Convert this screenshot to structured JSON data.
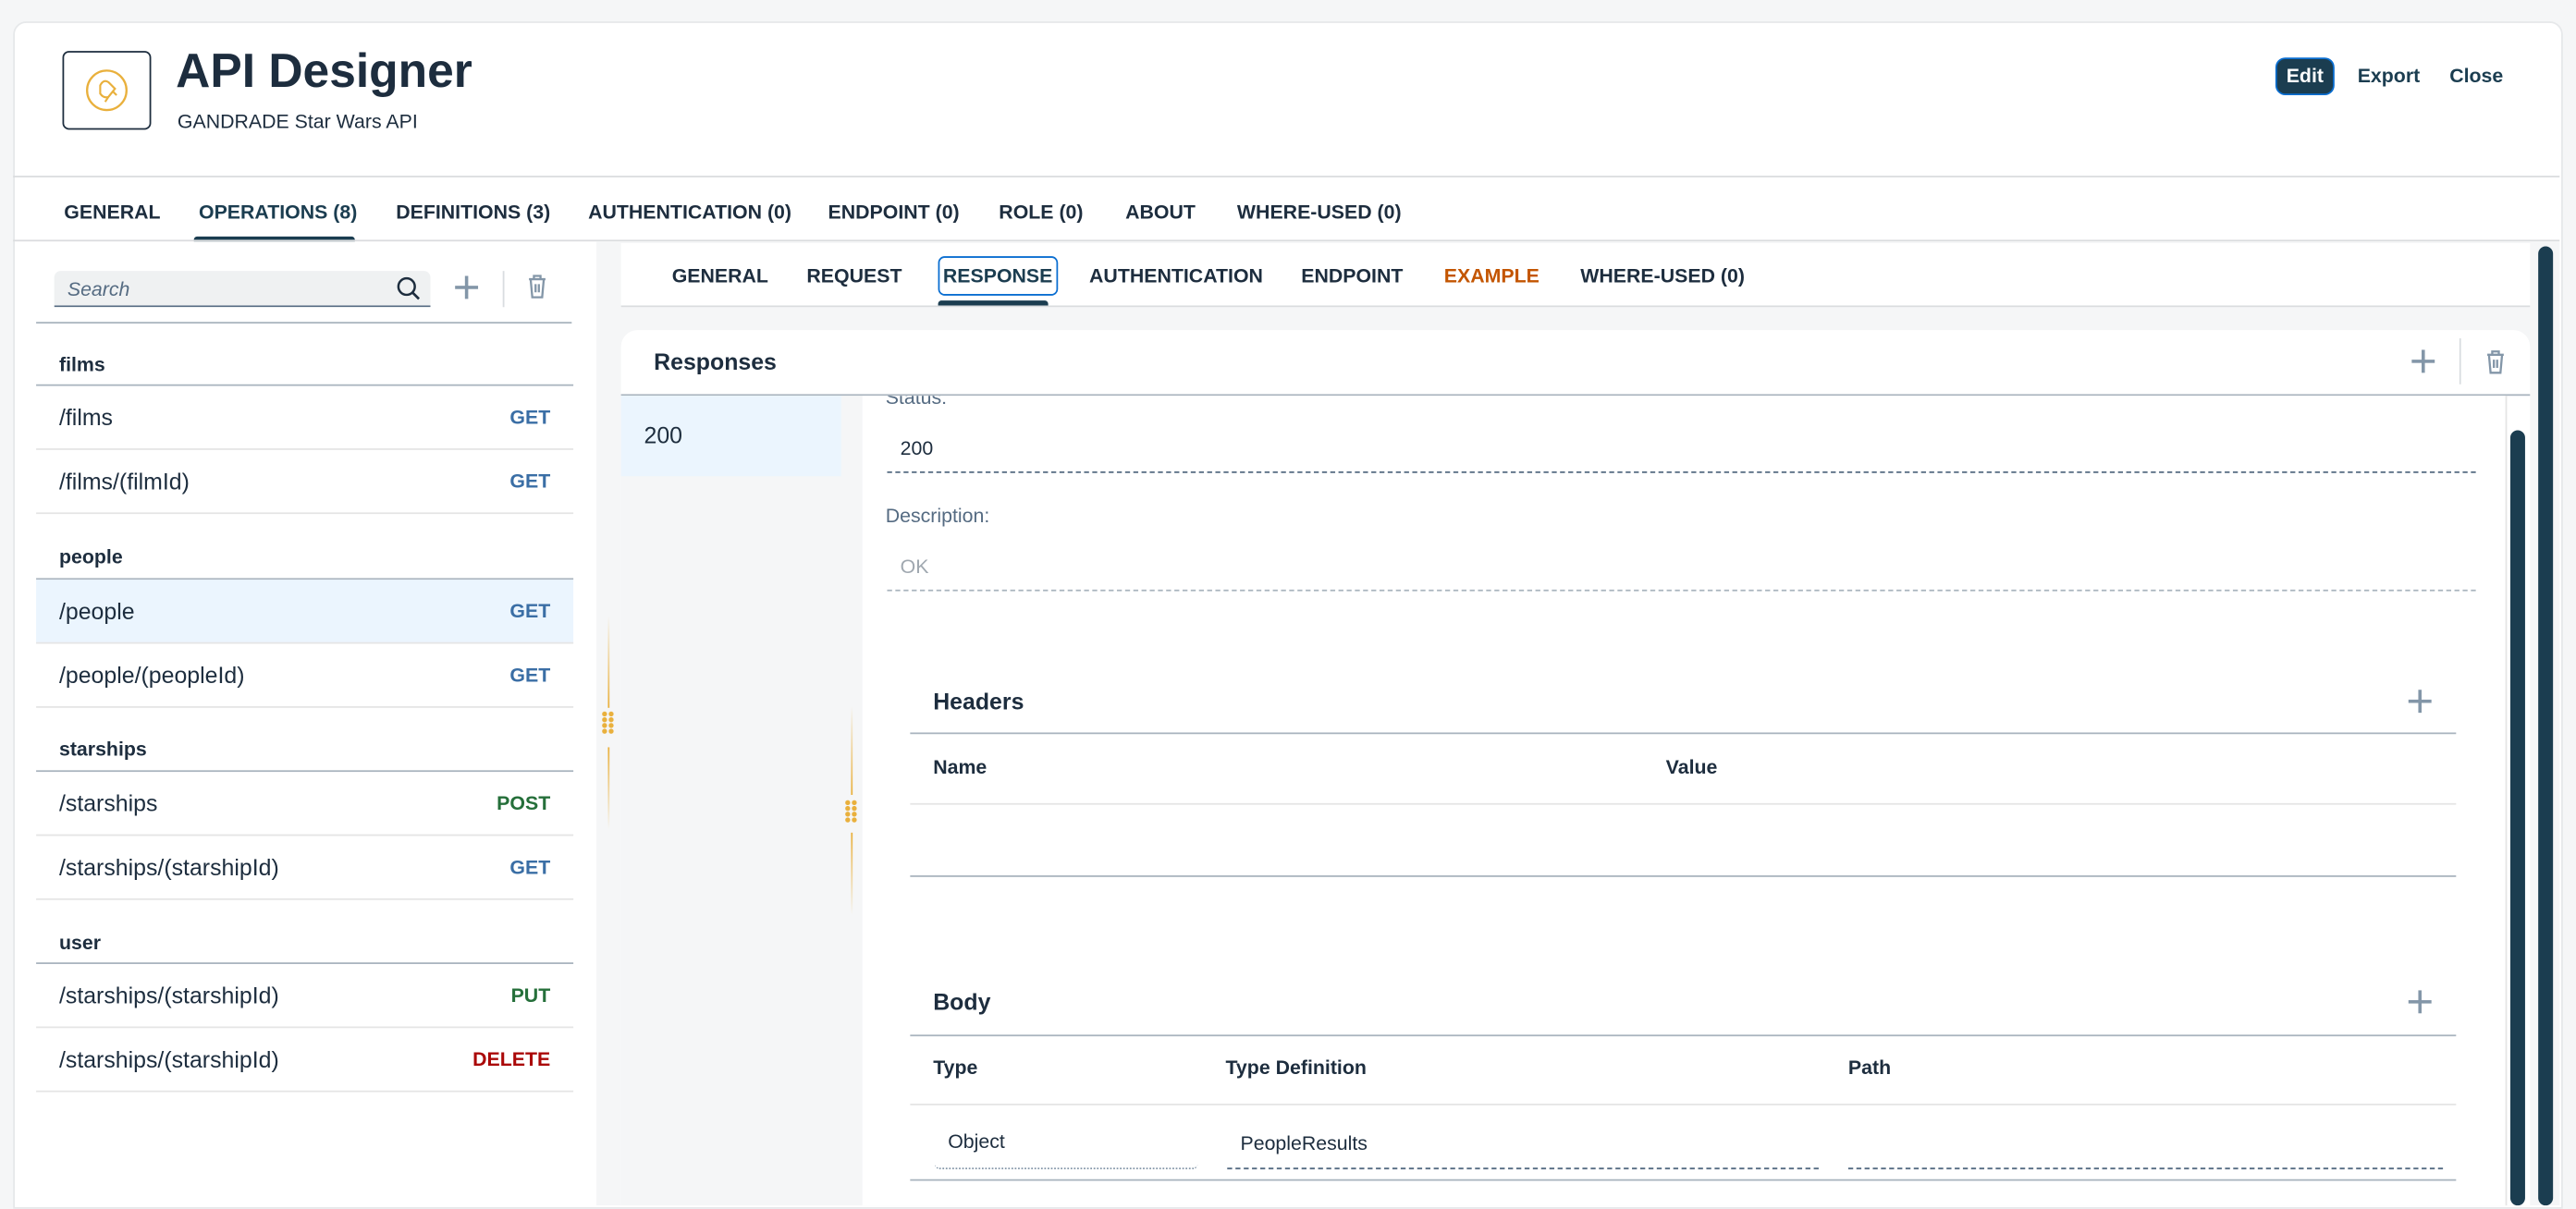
{
  "header": {
    "title": "API Designer",
    "subtitle": "GANDRADE Star Wars API",
    "logo_icon": "api-plug-icon",
    "actions": {
      "edit": "Edit",
      "export": "Export",
      "close": "Close"
    }
  },
  "main_tabs": [
    {
      "label": "GENERAL"
    },
    {
      "label": "OPERATIONS (8)",
      "selected": true
    },
    {
      "label": "DEFINITIONS (3)"
    },
    {
      "label": "AUTHENTICATION (0)"
    },
    {
      "label": "ENDPOINT (0)"
    },
    {
      "label": "ROLE (0)"
    },
    {
      "label": "ABOUT"
    },
    {
      "label": "WHERE-USED (0)"
    }
  ],
  "sidebar": {
    "search_placeholder": "Search",
    "groups": [
      {
        "name": "films",
        "items": [
          {
            "path": "/films",
            "method": "GET"
          },
          {
            "path": "/films/(filmId)",
            "method": "GET"
          }
        ]
      },
      {
        "name": "people",
        "items": [
          {
            "path": "/people",
            "method": "GET",
            "selected": true
          },
          {
            "path": "/people/(peopleId)",
            "method": "GET"
          }
        ]
      },
      {
        "name": "starships",
        "items": [
          {
            "path": "/starships",
            "method": "POST"
          },
          {
            "path": "/starships/(starshipId)",
            "method": "GET"
          }
        ]
      },
      {
        "name": "user",
        "items": [
          {
            "path": "/starships/(starshipId)",
            "method": "PUT"
          },
          {
            "path": "/starships/(starshipId)",
            "method": "DELETE"
          }
        ]
      }
    ]
  },
  "sub_tabs": [
    {
      "label": "GENERAL"
    },
    {
      "label": "REQUEST"
    },
    {
      "label": "RESPONSE",
      "selected": true
    },
    {
      "label": "AUTHENTICATION"
    },
    {
      "label": "ENDPOINT"
    },
    {
      "label": "EXAMPLE",
      "highlight": true
    },
    {
      "label": "WHERE-USED (0)"
    }
  ],
  "responses": {
    "title": "Responses",
    "list": [
      "200"
    ],
    "status_label": "Status:",
    "status_value": "200",
    "description_label": "Description:",
    "description_placeholder": "OK",
    "headers": {
      "title": "Headers",
      "columns": [
        "Name",
        "Value"
      ],
      "rows": []
    },
    "body": {
      "title": "Body",
      "columns": [
        "Type",
        "Type Definition",
        "Path"
      ],
      "rows": [
        {
          "type": "Object",
          "type_definition": "PeopleResults",
          "path": ""
        }
      ]
    }
  },
  "colors": {
    "text": "#1d2d3e",
    "accent": "#1b3d50",
    "focus": "#0a6ed1",
    "get": "#3a6ea5",
    "post": "#256f3a",
    "put": "#256f3a",
    "delete": "#aa0808",
    "example": "#c35500",
    "selected_row": "#ebf5fe",
    "grip": "#e9b03c"
  }
}
